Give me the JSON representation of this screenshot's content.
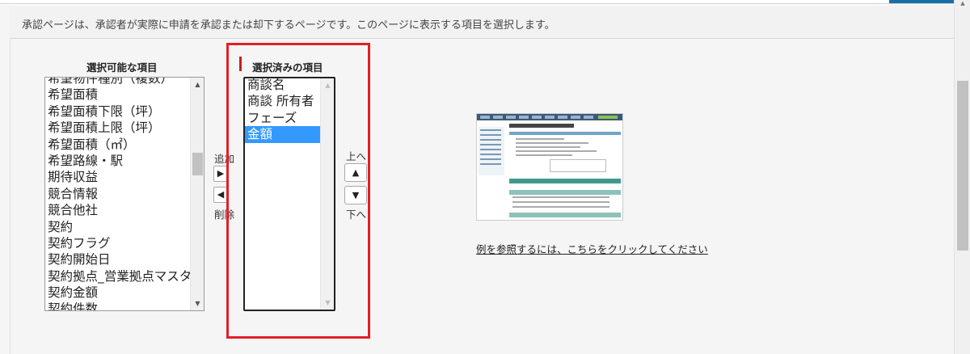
{
  "description": "承認ページは、承認者が実際に申請を承認または却下するページです。このページに表示する項目を選択します。",
  "available": {
    "label": "選択可能な項目",
    "items": [
      "希望物件種別（複数）",
      "希望面積",
      "希望面積下限（坪）",
      "希望面積上限（坪）",
      "希望面積（㎡）",
      "希望路線・駅",
      "期待収益",
      "競合情報",
      "競合他社",
      "契約",
      "契約フラグ",
      "契約開始日",
      "契約拠点_営業拠点マスタ",
      "契約金額",
      "契約件数"
    ]
  },
  "selected": {
    "label": "選択済みの項目",
    "items": [
      "商談名",
      "商談 所有者",
      "フェーズ",
      "金額"
    ],
    "selected_index": 3
  },
  "buttons": {
    "add_label": "追加",
    "add_icon": "right-arrow-icon",
    "remove_label": "削除",
    "remove_icon": "left-arrow-icon",
    "up_label": "上へ",
    "up_icon": "up-triangle-icon",
    "down_label": "下へ",
    "down_icon": "down-triangle-icon"
  },
  "example_link": "例を参照するには、こちらをクリックしてください",
  "colors": {
    "highlight": "#e31f26",
    "selection": "#3399ff"
  }
}
